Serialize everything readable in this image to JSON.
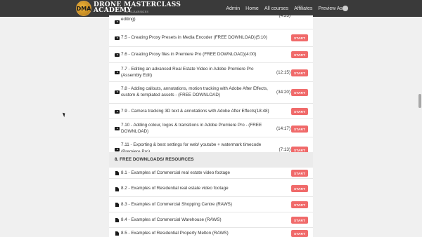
{
  "nav": {
    "logo": {
      "badge": "DMA",
      "line1": "DRONE MASTERCLASS",
      "line2": "ACADEMY",
      "line3": "BY CLEARSKIES"
    },
    "links": [
      "Admin",
      "Home",
      "All courses",
      "Affiliates"
    ],
    "preview_label": "Preview As"
  },
  "start_label": "START",
  "lessons": [
    {
      "title": "editing)",
      "duration": "(4:23)"
    },
    {
      "title": "7.5 - Creating Proxy Presets in Media Encoder (FREE DOWNLOAD)(5:10)",
      "duration": ""
    },
    {
      "title": "7.6 - Creating Proxy files in Premiere Pro (FREE DOWNLOAD)(4:00)",
      "duration": ""
    },
    {
      "title": "7.7 - Editing an advanced Real Estate Video in Adobe Premiere Pro (Assembly Edit)",
      "duration": "(12:15)"
    },
    {
      "title": "7.8 - Adding callouts, annotations, motion tracking with Adobe After Effects, custom & templated assets - (FREE DOWNLOAD)",
      "duration": "(34:20)"
    },
    {
      "title": "7.9 - Camera tracking 3D text & annotations with Adobe After Effects(18:48)",
      "duration": ""
    },
    {
      "title": "7.10 - Adding colour, logos & transitions in Adobe Premiere Pro - (FREE DOWNLOAD)",
      "duration": "(14:17)"
    },
    {
      "title": "7.11 - Exporting & best settings for web/ youtube + watermark timecode (Premiere Pro)",
      "duration": "(7:13)"
    }
  ],
  "section8": {
    "title": "8. FREE DOWNLOADS/ RESOURCES",
    "items": [
      {
        "title": "8.1 - Examples of Commercial real estate video footage"
      },
      {
        "title": "8.2 - Examples of Residential real estate video footage"
      },
      {
        "title": "8.3 - Examples of Commercial Shopping Centre (RAWS)"
      },
      {
        "title": "8.4 - Examples of Commercial Warehouse (RAWS)"
      },
      {
        "title": "8.5 - Examples of Residential Property Melton (RAWS)"
      }
    ]
  }
}
